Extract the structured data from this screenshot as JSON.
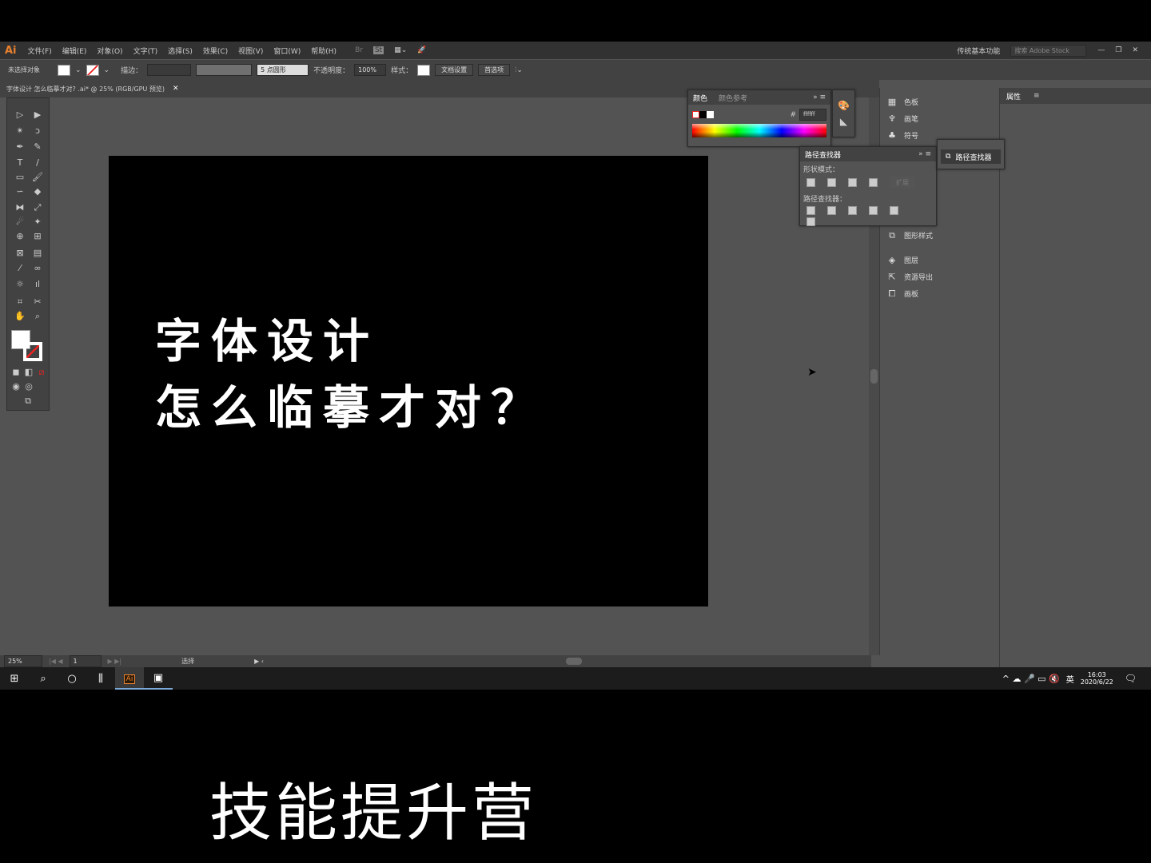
{
  "app": {
    "logo": "Ai",
    "menus": [
      "文件(F)",
      "编辑(E)",
      "对象(O)",
      "文字(T)",
      "选择(S)",
      "效果(C)",
      "视图(V)",
      "窗口(W)",
      "帮助(H)"
    ],
    "bridge": "Br",
    "stock": "St",
    "workspace": "传统基本功能",
    "search_placeholder": "搜索 Adobe Stock"
  },
  "control": {
    "selection": "未选择对象",
    "stroke_label": "描边：",
    "brush": "5 点圆形",
    "opacity_label": "不透明度：",
    "opacity": "100%",
    "style_label": "样式：",
    "doc_setup": "文档设置",
    "prefs": "首选项"
  },
  "document": {
    "tab": "字体设计 怎么临摹才对? .ai* @ 25% (RGB/GPU 预览)"
  },
  "artboard": {
    "line1": "字体设计",
    "line2": "怎么临摹才对？"
  },
  "color_panel": {
    "tab1": "颜色",
    "tab2": "颜色参考",
    "hex": "ffffff"
  },
  "pathfinder": {
    "title": "路径查找器",
    "shape_modes": "形状模式：",
    "expand": "扩展",
    "pathfinders": "路径查找器：",
    "collapsed": "路径查找器"
  },
  "dock": {
    "items": [
      "色板",
      "画笔",
      "符号",
      "图形样式",
      "图层",
      "资源导出",
      "画板"
    ]
  },
  "properties": {
    "tab": "属性"
  },
  "status": {
    "zoom": "25%",
    "page": "1",
    "tool": "选择"
  },
  "taskbar": {
    "time": "16:03",
    "date": "2020/6/22",
    "ime": "英"
  },
  "caption": "技能提升营",
  "colors": {
    "accent": "#e8812d",
    "canvas": "#535353",
    "panel": "#424242"
  }
}
